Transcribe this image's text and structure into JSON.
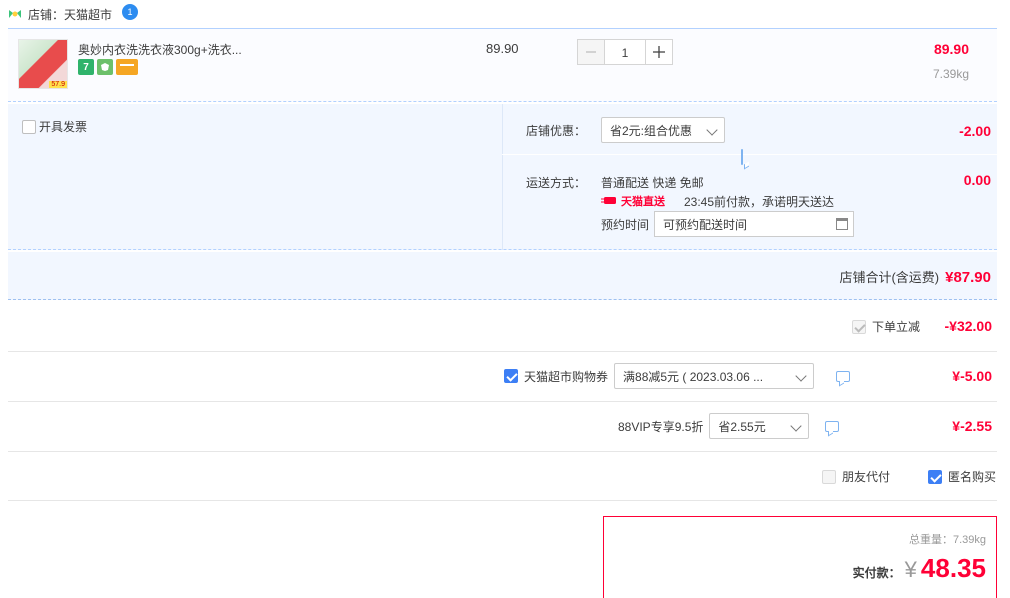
{
  "store": {
    "label": "店铺：天猫超市",
    "badge": "1"
  },
  "item": {
    "title": "奥妙内衣洗洗衣液300g+洗衣...",
    "unit_price": "89.90",
    "quantity": "1",
    "total": "89.90",
    "weight": "7.39kg",
    "image_tag": "57.9",
    "icon_seven": "7"
  },
  "invoice": {
    "label": "开具发票"
  },
  "store_discount": {
    "label": "店铺优惠：",
    "selected": "省2元:组合优惠",
    "amount": "-2.00"
  },
  "shipping": {
    "label": "运送方式：",
    "method": "普通配送 快递 免邮",
    "amount": "0.00",
    "direct_label": "天猫直送",
    "promise": "23:45前付款，承诺明天送达",
    "reserve_label": "预约时间",
    "reserve_placeholder": "可预约配送时间"
  },
  "store_total": {
    "label": "店铺合计(含运费)",
    "amount": "¥87.90"
  },
  "instant_discount": {
    "label": "下单立减",
    "amount": "-¥32.00"
  },
  "coupon": {
    "label": "天猫超市购物券",
    "selected": "满88减5元 ( 2023.03.06 ...",
    "amount": "¥-5.00"
  },
  "vip": {
    "label": "88VIP专享9.5折",
    "selected": "省2.55元",
    "amount": "¥-2.55"
  },
  "options": {
    "friend_pay": "朋友代付",
    "anonymous": "匿名购买"
  },
  "payment": {
    "total_weight": "总重量：7.39kg",
    "label": "实付款：",
    "currency": "¥",
    "amount": "48.35"
  },
  "colors": {
    "accent_red": "#ff0036",
    "accent_blue": "#3d7ff5",
    "panel_bg": "#f2f7ff"
  }
}
